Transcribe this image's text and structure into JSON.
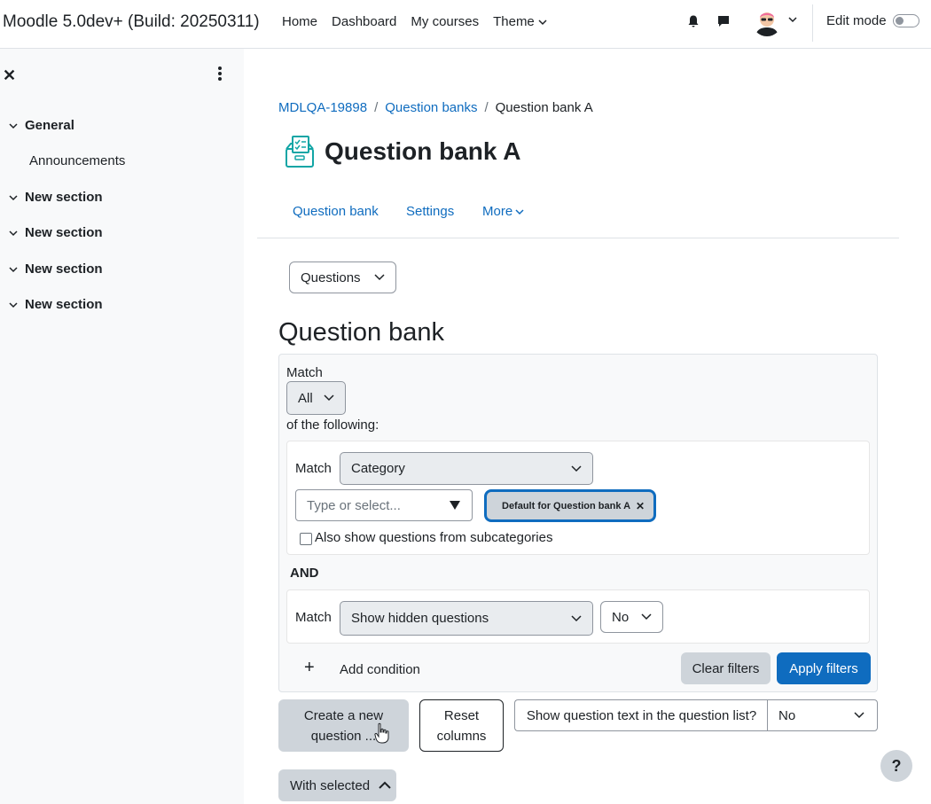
{
  "navbar": {
    "site_name": "Moodle 5.0dev+ (Build: 20250311)",
    "links": [
      "Home",
      "Dashboard",
      "My courses"
    ],
    "theme_label": "Theme",
    "edit_mode_label": "Edit mode",
    "edit_mode_on": false
  },
  "drawer": {
    "sections": [
      {
        "label": "General",
        "items": [
          "Announcements"
        ]
      },
      {
        "label": "New section",
        "items": []
      },
      {
        "label": "New section",
        "items": []
      },
      {
        "label": "New section",
        "items": []
      },
      {
        "label": "New section",
        "items": []
      }
    ]
  },
  "breadcrumb": [
    "MDLQA-19898",
    "Question banks",
    "Question bank A"
  ],
  "page_title": "Question bank A",
  "secondary_nav": [
    "Question bank",
    "Settings",
    "More"
  ],
  "view_select": "Questions",
  "section_heading": "Question bank",
  "filters": {
    "match_label": "Match",
    "match_value": "All",
    "of_following": "of the following:",
    "condition1": {
      "match_label": "Match",
      "type": "Category",
      "search_placeholder": "Type or select...",
      "selected": "Default for Question bank A",
      "subcategories_label": "Also show questions from subcategories",
      "subcategories_checked": false
    },
    "join_label": "AND",
    "condition2": {
      "match_label": "Match",
      "type": "Show hidden questions",
      "value": "No"
    },
    "add_condition": "Add condition",
    "clear_filters": "Clear filters",
    "apply_filters": "Apply filters"
  },
  "actions": {
    "create_line1": "Create a new",
    "create_line2": "question ...",
    "reset_line1": "Reset",
    "reset_line2": "columns",
    "show_text_label": "Show question text in the question list?",
    "show_text_value": "No",
    "with_selected": "With selected"
  },
  "help_label": "?",
  "colors": {
    "primary": "#0f6cbf",
    "text": "#1d2125",
    "drawer_bg": "#f8f9fa",
    "secondary_btn": "#ced4da"
  }
}
